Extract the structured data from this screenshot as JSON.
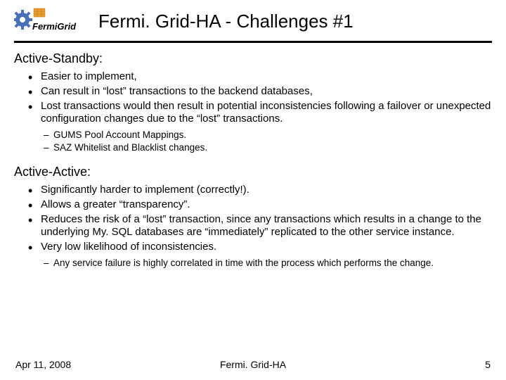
{
  "title": "Fermi. Grid-HA - Challenges #1",
  "section1": {
    "heading": "Active-Standby:",
    "bullets": [
      "Easier to implement,",
      "Can result in “lost” transactions to the backend databases,",
      "Lost transactions would then result in potential inconsistencies following a failover or unexpected configuration changes due to the “lost” transactions."
    ],
    "subbullets": [
      "GUMS Pool Account Mappings.",
      "SAZ Whitelist and Blacklist changes."
    ]
  },
  "section2": {
    "heading": "Active-Active:",
    "bullets": [
      "Significantly harder to implement (correctly!).",
      "Allows a greater “transparency”.",
      "Reduces the risk of a “lost” transaction, since any transactions which results in a change to the underlying My. SQL databases are “immediately” replicated to the other service instance.",
      "Very low likelihood of inconsistencies."
    ],
    "subbullets": [
      "Any service failure is highly correlated in time with the process which performs the change."
    ]
  },
  "footer": {
    "date": "Apr 11, 2008",
    "center": "Fermi. Grid-HA",
    "page": "5"
  }
}
